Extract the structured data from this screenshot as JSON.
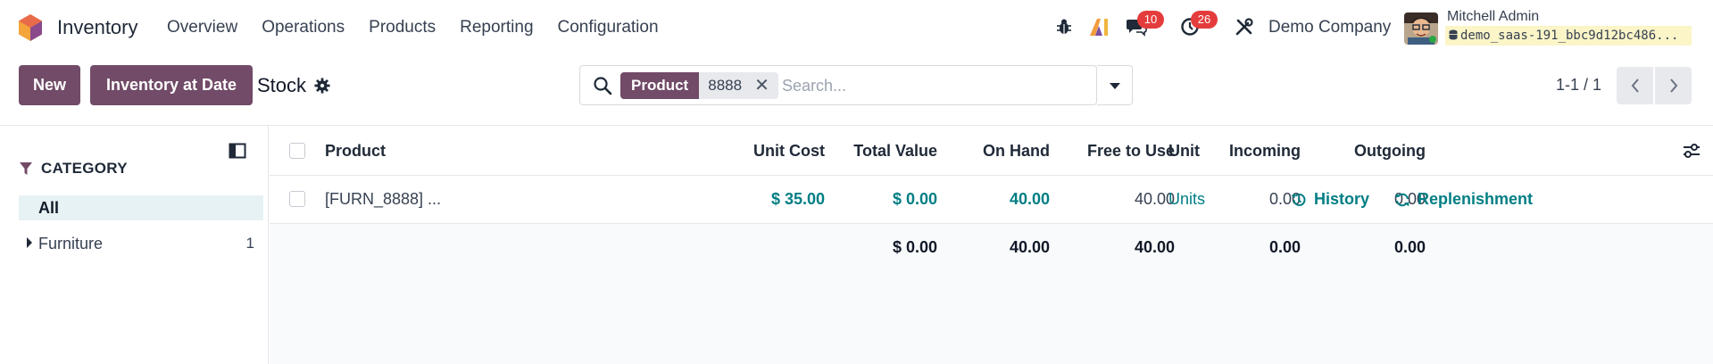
{
  "app": {
    "name": "Inventory"
  },
  "menu": [
    {
      "label": "Overview"
    },
    {
      "label": "Operations"
    },
    {
      "label": "Products"
    },
    {
      "label": "Reporting"
    },
    {
      "label": "Configuration"
    }
  ],
  "systray": {
    "messages_count": "10",
    "activities_count": "26",
    "company": "Demo Company",
    "user_name": "Mitchell Admin",
    "database": "demo_saas-191_bbc9d12bc486..."
  },
  "control": {
    "new_label": "New",
    "inventory_at_date_label": "Inventory at Date",
    "title": "Stock"
  },
  "search": {
    "facet_label": "Product",
    "facet_value": "8888",
    "placeholder": "Search..."
  },
  "pager": {
    "value": "1-1 / 1"
  },
  "side_panel": {
    "title": "CATEGORY",
    "all_label": "All",
    "categories": [
      {
        "name": "Furniture",
        "count": "1"
      }
    ]
  },
  "table": {
    "columns": {
      "product": "Product",
      "unit_cost": "Unit Cost",
      "total_value": "Total Value",
      "on_hand": "On Hand",
      "free_to_use": "Free to Use",
      "incoming": "Incoming",
      "outgoing": "Outgoing",
      "unit": "Unit"
    },
    "rows": [
      {
        "product": "[FURN_8888] ...",
        "unit_cost": "$ 35.00",
        "total_value": "$ 0.00",
        "on_hand": "40.00",
        "free_to_use": "40.00",
        "incoming": "0.00",
        "outgoing": "0.00",
        "unit": "Units",
        "history_label": "History",
        "replenishment_label": "Replenishment"
      }
    ],
    "totals": {
      "total_value": "$ 0.00",
      "on_hand": "40.00",
      "free_to_use": "40.00",
      "incoming": "0.00",
      "outgoing": "0.00"
    }
  },
  "colors": {
    "brand": "#714b67",
    "accent": "#017e84",
    "badge": "#e43c3c"
  }
}
